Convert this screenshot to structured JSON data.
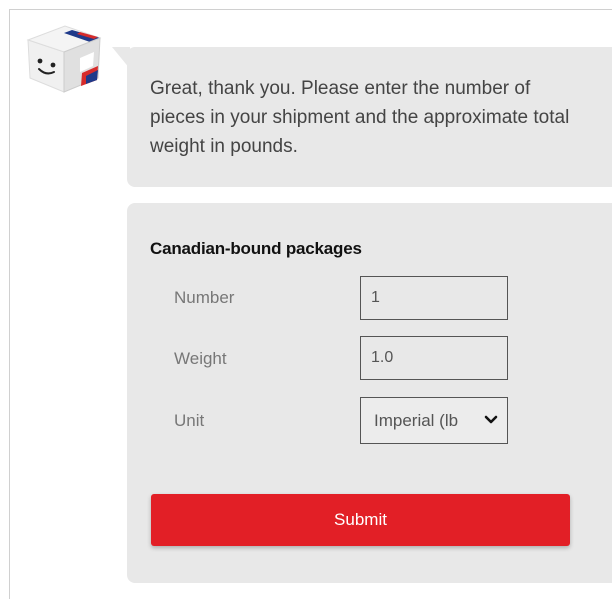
{
  "chat": {
    "message": "Great, thank you. Please enter the number of pieces in your shipment and the approximate total weight in pounds."
  },
  "form": {
    "title": "Canadian-bound packages",
    "number_label": "Number",
    "number_value": "1",
    "weight_label": "Weight",
    "weight_value": "1.0",
    "unit_label": "Unit",
    "unit_selected": "Imperial (lb",
    "submit_label": "Submit"
  },
  "colors": {
    "accent": "#e21f26",
    "bubble_bg": "#e8e8e8"
  },
  "icons": {
    "avatar": "cube-mascot-icon",
    "dropdown": "chevron-down-icon"
  }
}
